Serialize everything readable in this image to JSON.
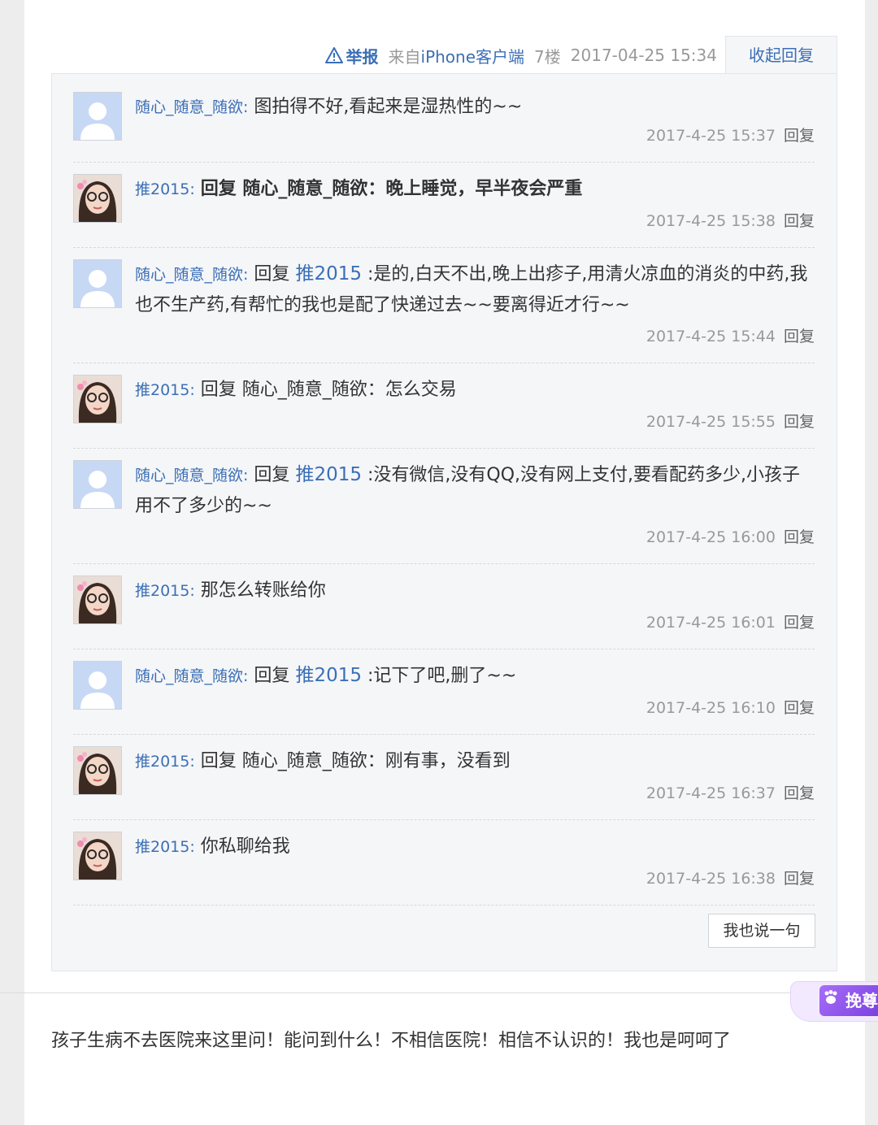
{
  "header": {
    "report_label": "举报",
    "source_prefix": "来自",
    "source_client": "iPhone客户端",
    "floor": "7楼",
    "post_time": "2017-04-25 15:34",
    "collapse_label": "收起回复"
  },
  "replies": [
    {
      "user": "随心_随意_随欲",
      "avatar": "default",
      "target": "",
      "text": "图拍得不好,看起来是湿热性的~~",
      "bold": false,
      "time": "2017-4-25 15:37"
    },
    {
      "user": "推2015",
      "avatar": "photo",
      "target": "",
      "text": "回复 随心_随意_随欲：晚上睡觉，早半夜会严重",
      "bold": true,
      "time": "2017-4-25 15:38"
    },
    {
      "user": "随心_随意_随欲",
      "avatar": "default",
      "target": "推2015",
      "text": ":是的,白天不出,晚上出疹子,用清火凉血的消炎的中药,我也不生产药,有帮忙的我也是配了快递过去~~要离得近才行~~",
      "bold": false,
      "time": "2017-4-25 15:44"
    },
    {
      "user": "推2015",
      "avatar": "photo",
      "target": "",
      "text": "回复 随心_随意_随欲：怎么交易",
      "bold": false,
      "time": "2017-4-25 15:55"
    },
    {
      "user": "随心_随意_随欲",
      "avatar": "default",
      "target": "推2015",
      "text": ":没有微信,没有QQ,没有网上支付,要看配药多少,小孩子用不了多少的~~",
      "bold": false,
      "time": "2017-4-25 16:00"
    },
    {
      "user": "推2015",
      "avatar": "photo",
      "target": "",
      "text": "那怎么转账给你",
      "bold": false,
      "time": "2017-4-25 16:01"
    },
    {
      "user": "随心_随意_随欲",
      "avatar": "default",
      "target": "推2015",
      "text": ":记下了吧,删了~~",
      "bold": false,
      "time": "2017-4-25 16:10"
    },
    {
      "user": "推2015",
      "avatar": "photo",
      "target": "",
      "text": "回复 随心_随意_随欲：刚有事，没看到",
      "bold": false,
      "time": "2017-4-25 16:37"
    },
    {
      "user": "推2015",
      "avatar": "photo",
      "target": "",
      "text": "你私聊给我",
      "bold": false,
      "time": "2017-4-25 16:38"
    }
  ],
  "labels": {
    "reply_word": "回复",
    "reply_action": "回复",
    "colon": ":"
  },
  "say_button": "我也说一句",
  "next_post_text": "孩子生病不去医院来这里问！能问到什么！不相信医院！相信不认识的！我也是呵呵了",
  "badge_text": "挽尊",
  "colors": {
    "link": "#3b6fb6",
    "panel": "#f5f6f8",
    "badge": "#8a4ff0"
  }
}
